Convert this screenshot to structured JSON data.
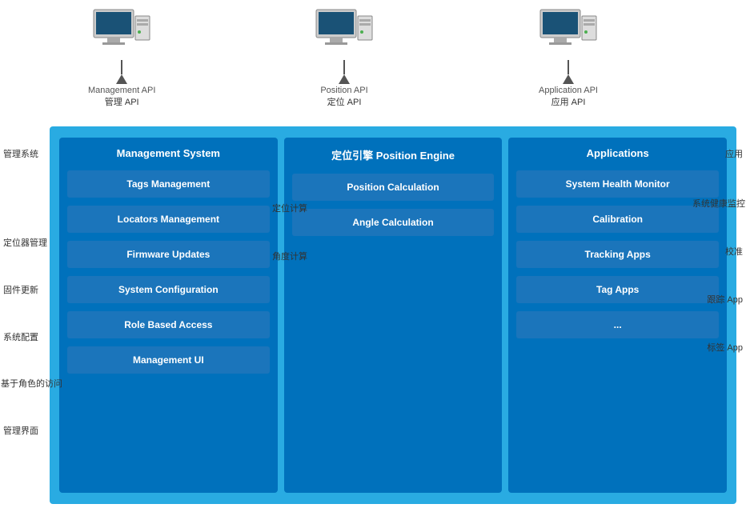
{
  "computers": [
    {
      "api_en": "Management API",
      "api_cn": "管理 API"
    },
    {
      "api_en": "Position API",
      "api_cn": "定位 API"
    },
    {
      "api_en": "Application API",
      "api_cn": "应用 API"
    }
  ],
  "panels": [
    {
      "id": "management",
      "title_en": "Management System",
      "title_cn": "",
      "left_label": "管理系统",
      "buttons": [
        {
          "label": "Tags Management",
          "left_cn": ""
        },
        {
          "label": "Locators Management",
          "left_cn": "定位器管理"
        },
        {
          "label": "Firmware Updates",
          "left_cn": "固件更新"
        },
        {
          "label": "System Configuration",
          "left_cn": "系统配置"
        },
        {
          "label": "Role Based Access",
          "left_cn": "基于角色的访问"
        },
        {
          "label": "Management UI",
          "left_cn": "管理界面"
        }
      ]
    },
    {
      "id": "position",
      "title_en": "Position Engine",
      "title_cn": "定位引擎",
      "left_label": "",
      "buttons": [
        {
          "label": "Position Calculation",
          "left_cn": "定位计算"
        },
        {
          "label": "Angle Calculation",
          "left_cn": "角度计算"
        }
      ]
    },
    {
      "id": "applications",
      "title_en": "Applications",
      "title_cn": "应用",
      "left_label": "",
      "buttons": [
        {
          "label": "System Health Monitor",
          "right_cn": "系统健康监控"
        },
        {
          "label": "Calibration",
          "right_cn": "校准"
        },
        {
          "label": "Tracking Apps",
          "right_cn": "跟踪 App"
        },
        {
          "label": "Tag Apps",
          "right_cn": "标签 App"
        },
        {
          "label": "...",
          "right_cn": ""
        }
      ]
    }
  ]
}
